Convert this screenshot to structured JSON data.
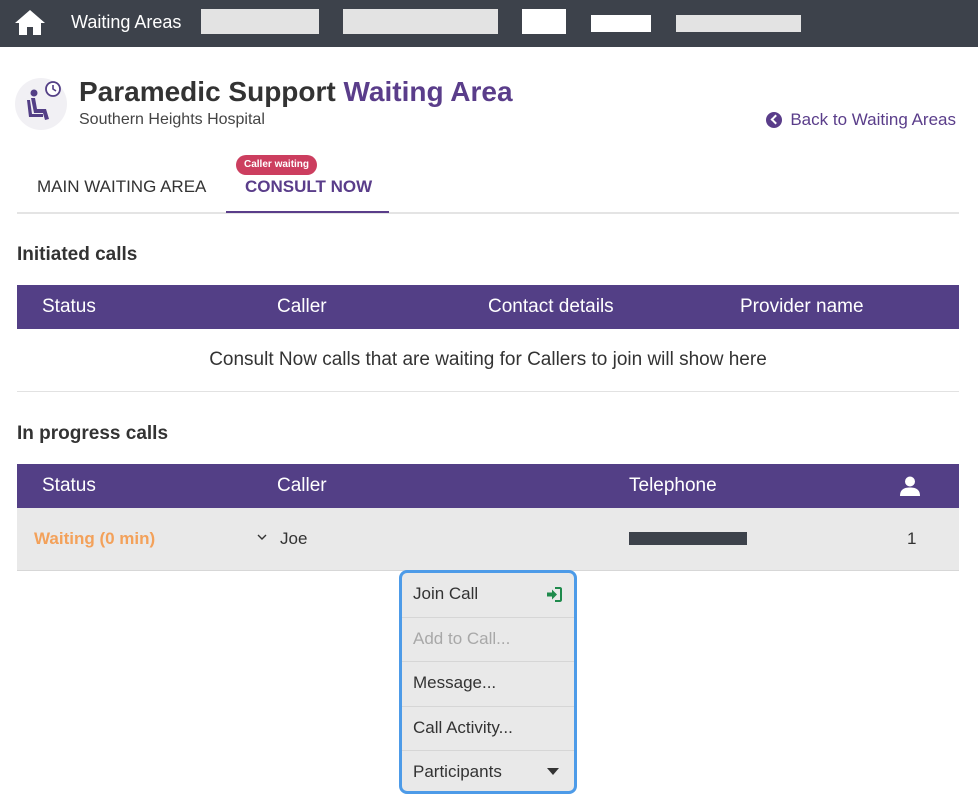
{
  "nav": {
    "brand": "Waiting Areas",
    "placeholders": [
      {
        "style": "grey"
      },
      {
        "style": "grey"
      },
      {
        "style": "white"
      },
      {
        "style": "white"
      },
      {
        "style": "grey"
      }
    ]
  },
  "header": {
    "title_main": "Paramedic Support",
    "title_accent": "Waiting Area",
    "subtitle": "Southern Heights Hospital",
    "back_link": "Back to Waiting Areas"
  },
  "tabs": [
    {
      "label": "MAIN WAITING AREA",
      "active": false
    },
    {
      "label": "CONSULT NOW",
      "active": true,
      "badge": "Caller waiting"
    }
  ],
  "initiated": {
    "heading": "Initiated calls",
    "columns": [
      "Status",
      "Caller",
      "Contact details",
      "Provider name"
    ],
    "empty_message": "Consult Now calls that are waiting for Callers to join will show here"
  },
  "in_progress": {
    "heading": "In progress calls",
    "columns": [
      "Status",
      "Caller",
      "Telephone"
    ],
    "participants_icon": "user-icon",
    "rows": [
      {
        "status": "Waiting (0 min)",
        "caller": "Joe",
        "telephone_redacted": true,
        "participants": "1"
      }
    ]
  },
  "call_menu": {
    "items": [
      {
        "label": "Join Call",
        "icon": "sign-in-icon",
        "enabled": true
      },
      {
        "label": "Add to Call...",
        "enabled": false
      },
      {
        "label": "Message...",
        "enabled": true
      },
      {
        "label": "Call Activity...",
        "enabled": true
      },
      {
        "label": "Participants",
        "icon": "caret-down-icon",
        "enabled": true
      }
    ]
  },
  "colors": {
    "topbar": "#3d424b",
    "brand_purple": "#533f86",
    "accent_purple": "#5a3d8a",
    "waiting_orange": "#f3a15a",
    "badge_red": "#cc3e5f",
    "menu_focus": "#4d9be8",
    "join_green": "#1f8a4c"
  }
}
